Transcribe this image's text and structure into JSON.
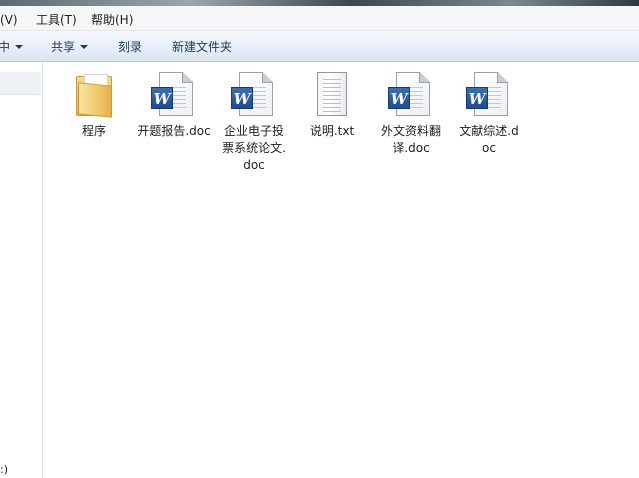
{
  "menubar": {
    "items": [
      "看(V)",
      "工具(T)",
      "帮助(H)"
    ]
  },
  "toolbar": {
    "organize_tail": "中",
    "share": "共享",
    "burn": "刻录",
    "new_folder": "新建文件夹"
  },
  "nav_pane": {
    "bottom_text": ":)"
  },
  "files": [
    {
      "name": "程序",
      "type": "folder-icon"
    },
    {
      "name": "开题报告.doc",
      "type": "word-document-icon"
    },
    {
      "name": "企业电子投票系统论文.doc",
      "type": "word-document-icon"
    },
    {
      "name": "说明.txt",
      "type": "text-document-icon"
    },
    {
      "name": "外文资料翻译.doc",
      "type": "word-document-icon"
    },
    {
      "name": "文献综述.doc",
      "type": "word-document-icon"
    }
  ],
  "colors": {
    "toolbar_text": "#1e395b",
    "word_badge": "#2b5797",
    "folder": "#f0c867"
  }
}
